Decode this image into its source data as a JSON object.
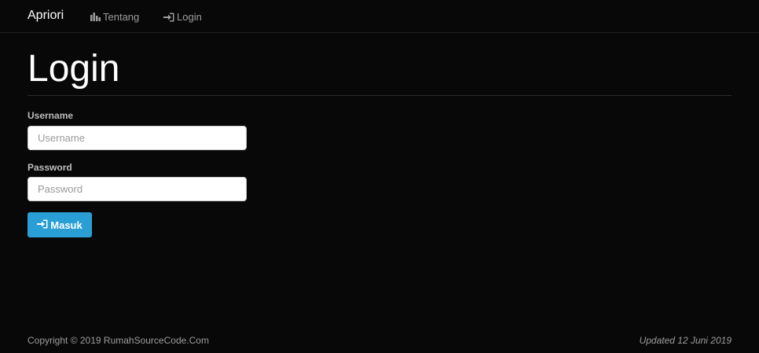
{
  "navbar": {
    "brand": "Apriori",
    "links": [
      {
        "label": "Tentang",
        "icon": "bar-chart-icon"
      },
      {
        "label": "Login",
        "icon": "sign-in-icon"
      }
    ]
  },
  "page": {
    "title": "Login"
  },
  "form": {
    "username": {
      "label": "Username",
      "value": "",
      "placeholder": "Username"
    },
    "password": {
      "label": "Password",
      "value": "",
      "placeholder": "Password"
    },
    "submit": {
      "label": "Masuk",
      "icon": "sign-in-icon"
    }
  },
  "footer": {
    "copyright": "Copyright © 2019 RumahSourceCode.Com",
    "updated": "Updated 12 Juni 2019"
  },
  "colors": {
    "background": "#080808",
    "primary_button": "#2a9fd6",
    "nav_text": "#9d9d9d"
  }
}
